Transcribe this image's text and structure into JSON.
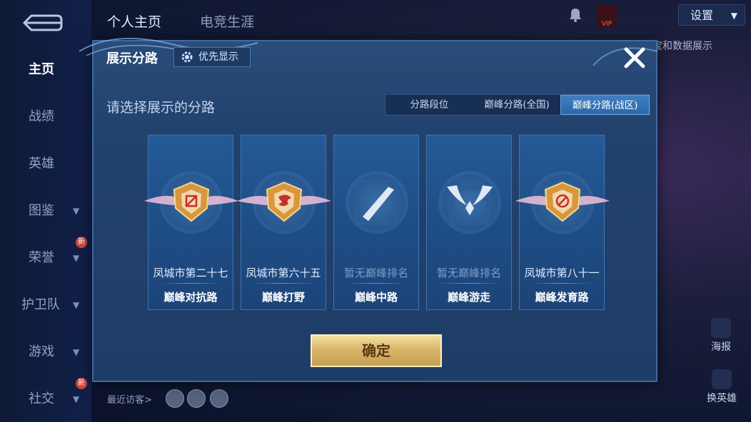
{
  "nav": {
    "items": [
      {
        "label": "主页",
        "active": true
      },
      {
        "label": "战绩"
      },
      {
        "label": "英雄"
      },
      {
        "label": "图鉴",
        "chevron": true
      },
      {
        "label": "荣誉",
        "chevron": true,
        "badge": "新"
      },
      {
        "label": "护卫队",
        "chevron": true
      },
      {
        "label": "游戏",
        "chevron": true
      },
      {
        "label": "社交",
        "chevron": true,
        "badge": "新"
      }
    ]
  },
  "header": {
    "tabs": [
      "个人主页",
      "电竞生涯"
    ],
    "vip_text": "VIP",
    "vip_sub": "",
    "settings_label": "设置",
    "peek_text": "宝和数据展示"
  },
  "footer": {
    "visitors_label": "最近访客>",
    "poster_label": "海报",
    "switch_hero_label": "换英雄"
  },
  "modal": {
    "title": "展示分路",
    "priority_label": "优先显示",
    "subtitle": "请选择展示的分路",
    "segments": [
      "分路段位",
      "巅峰分路(全国)",
      "巅峰分路(战区)"
    ],
    "active_segment": 2,
    "cards": [
      {
        "rank": "凤城市第二十七",
        "lane": "巅峰对抗路",
        "emblem": "gold-badge",
        "ranked": true
      },
      {
        "rank": "凤城市第六十五",
        "lane": "巅峰打野",
        "emblem": "gold-badge",
        "ranked": true
      },
      {
        "rank": "暂无巅峰排名",
        "lane": "巅峰中路",
        "emblem": "mid-lane-icon",
        "ranked": false
      },
      {
        "rank": "暂无巅峰排名",
        "lane": "巅峰游走",
        "emblem": "support-wings-icon",
        "ranked": false
      },
      {
        "rank": "凤城市第八十一",
        "lane": "巅峰发育路",
        "emblem": "gold-badge",
        "ranked": true
      }
    ],
    "confirm_label": "确定"
  },
  "colors": {
    "accent": "#2d68a8",
    "confirm_gold": "#d9b66a",
    "card_bg": "#245a98"
  }
}
